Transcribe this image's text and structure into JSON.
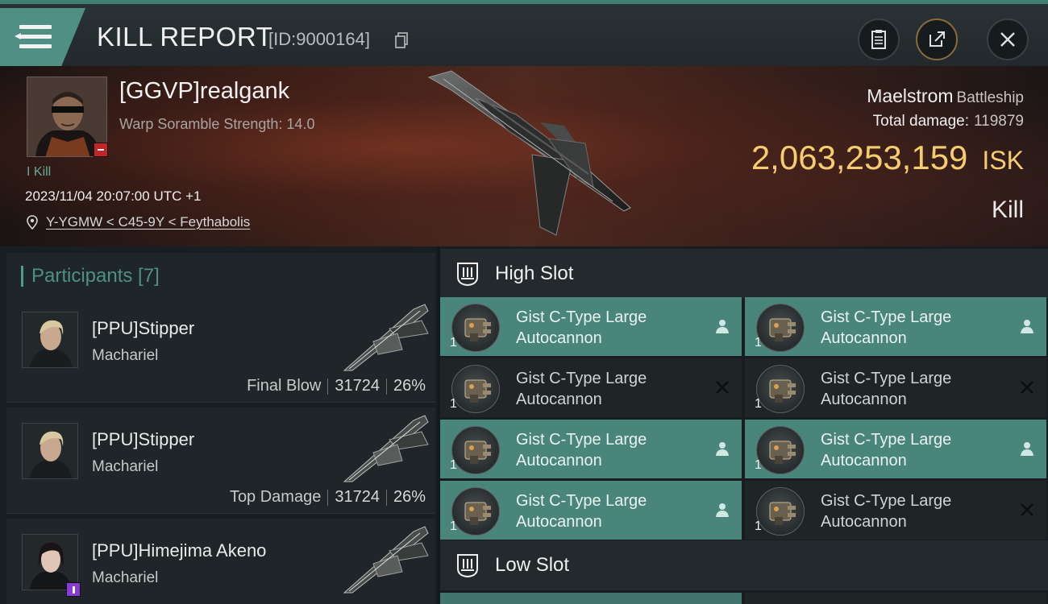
{
  "header": {
    "title": "KILL REPORT",
    "report_id": "[ID:9000164]"
  },
  "victim": {
    "name": "[GGVP]realgank",
    "scramble": "Warp Soramble Strength: 14.0",
    "kills": "I Kill",
    "datetime": "2023/11/04 20:07:00 UTC +1",
    "location": "Y-YGMW < C45-9Y < Feythabolis"
  },
  "ship": {
    "name": "Maelstrom",
    "class": "Battleship",
    "total_damage_label": "Total damage:",
    "total_damage": "119879",
    "isk_value": "2,063,253,159",
    "isk_unit": "ISK",
    "kill_type": "Kill"
  },
  "participants": {
    "title": "Participants [7]",
    "rows": [
      {
        "name": "[PPU]Stipper",
        "ship": "Machariel",
        "role": "Final Blow",
        "damage": "31724",
        "percent": "26%"
      },
      {
        "name": "[PPU]Stipper",
        "ship": "Machariel",
        "role": "Top Damage",
        "damage": "31724",
        "percent": "26%"
      },
      {
        "name": "[PPU]Himejima Akeno",
        "ship": "Machariel",
        "role": "",
        "damage": "",
        "percent": ""
      }
    ]
  },
  "slots": {
    "high_title": "High Slot",
    "low_title": "Low Slot",
    "high": [
      {
        "name_line1": "Gist C-Type Large",
        "name_line2": "Autocannon",
        "qty": "1",
        "status": "fitted"
      },
      {
        "name_line1": "Gist C-Type Large",
        "name_line2": "Autocannon",
        "qty": "1",
        "status": "fitted"
      },
      {
        "name_line1": "Gist C-Type Large",
        "name_line2": "Autocannon",
        "qty": "1",
        "status": "destroyed"
      },
      {
        "name_line1": "Gist C-Type Large",
        "name_line2": "Autocannon",
        "qty": "1",
        "status": "destroyed"
      },
      {
        "name_line1": "Gist C-Type Large",
        "name_line2": "Autocannon",
        "qty": "1",
        "status": "fitted"
      },
      {
        "name_line1": "Gist C-Type Large",
        "name_line2": "Autocannon",
        "qty": "1",
        "status": "fitted"
      },
      {
        "name_line1": "Gist C-Type Large",
        "name_line2": "Autocannon",
        "qty": "1",
        "status": "fitted"
      },
      {
        "name_line1": "Gist C-Type Large",
        "name_line2": "Autocannon",
        "qty": "1",
        "status": "destroyed"
      }
    ]
  },
  "colors": {
    "accent_teal": "#4f8f84",
    "isk_gold": "#f5cc6e",
    "fitted_bg": "#4a857b",
    "dropped_bg": "#1f2427"
  },
  "icons": {
    "menu": "hamburger-menu-icon",
    "copy": "copy-icon",
    "clipboard": "clipboard-icon",
    "share": "share-icon",
    "close": "close-icon",
    "location": "location-pin-icon",
    "slot": "slot-icon",
    "pilot": "person-icon",
    "destroyed": "x-icon"
  }
}
